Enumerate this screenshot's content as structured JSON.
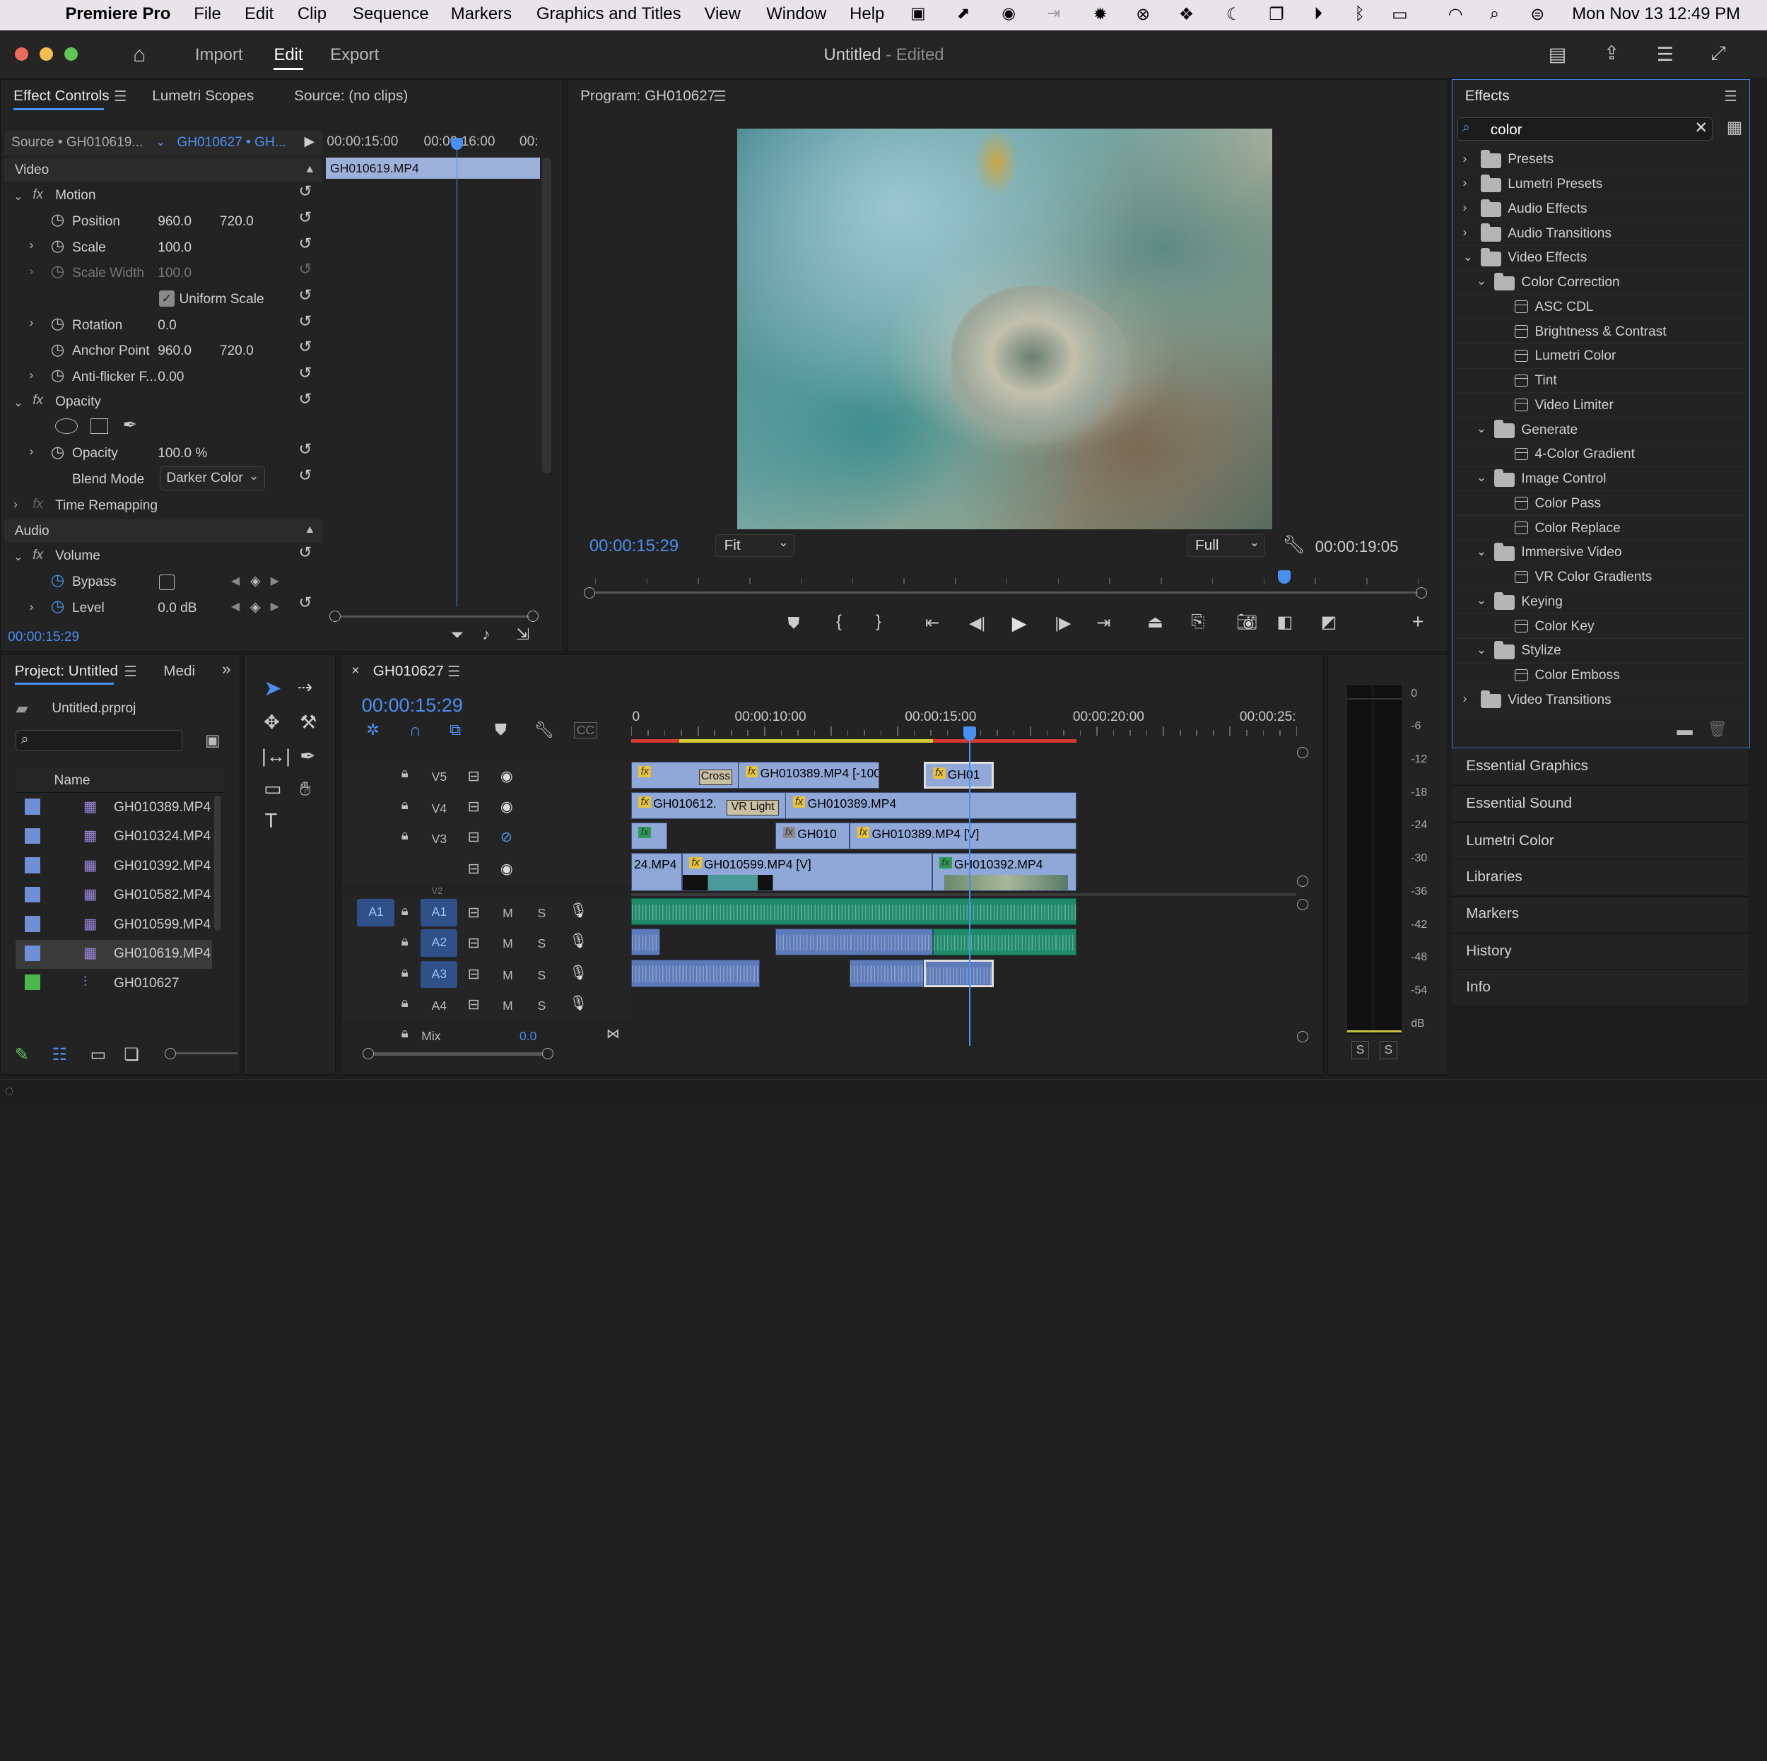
{
  "menubar": {
    "app": "Premiere Pro",
    "items": [
      "File",
      "Edit",
      "Clip",
      "Sequence",
      "Markers",
      "Graphics and Titles",
      "View",
      "Window",
      "Help"
    ],
    "datetime": "Mon Nov 13  12:49 PM"
  },
  "titlebar": {
    "tabs": [
      "Import",
      "Edit",
      "Export"
    ],
    "active_tab": "Edit",
    "doc_title": "Untitled",
    "doc_status": "- Edited"
  },
  "effect_controls": {
    "tabs": [
      "Effect Controls",
      "Lumetri Scopes",
      "Source: (no clips)"
    ],
    "source_label": "Source • GH010619...",
    "sequence_label": "GH010627 • GH...",
    "ruler_times": [
      "00:00:15:00",
      "00:00:16:00",
      "00:"
    ],
    "clip_name": "GH010619.MP4",
    "video_section": "Video",
    "motion": "Motion",
    "position_label": "Position",
    "position_x": "960.0",
    "position_y": "720.0",
    "scale_label": "Scale",
    "scale": "100.0",
    "scale_width_label": "Scale Width",
    "scale_width": "100.0",
    "uniform_scale": "Uniform Scale",
    "rotation_label": "Rotation",
    "rotation": "0.0",
    "anchor_label": "Anchor Point",
    "anchor_x": "960.0",
    "anchor_y": "720.0",
    "antiflicker_label": "Anti-flicker F...",
    "antiflicker": "0.00",
    "opacity_section": "Opacity",
    "opacity_label": "Opacity",
    "opacity": "100.0 %",
    "blend_label": "Blend Mode",
    "blend_mode": "Darker Color",
    "time_remap": "Time Remapping",
    "audio_section": "Audio",
    "volume": "Volume",
    "bypass_label": "Bypass",
    "level_label": "Level",
    "level": "0.0 dB",
    "current_time": "00:00:15:29"
  },
  "program": {
    "title": "Program: GH010627",
    "timecode": "00:00:15:29",
    "fit": "Fit",
    "quality": "Full",
    "duration": "00:00:19:05",
    "playhead_fraction": 0.837
  },
  "effects": {
    "title": "Effects",
    "search_value": "color",
    "tree": [
      {
        "label": "Presets",
        "level": 0,
        "type": "folder-star",
        "open": false
      },
      {
        "label": "Lumetri Presets",
        "level": 0,
        "type": "folder-star",
        "open": false
      },
      {
        "label": "Audio Effects",
        "level": 0,
        "type": "folder",
        "open": false
      },
      {
        "label": "Audio Transitions",
        "level": 0,
        "type": "folder",
        "open": false
      },
      {
        "label": "Video Effects",
        "level": 0,
        "type": "folder",
        "open": true
      },
      {
        "label": "Color Correction",
        "level": 1,
        "type": "folder",
        "open": true
      },
      {
        "label": "ASC CDL",
        "level": 2,
        "type": "fx"
      },
      {
        "label": "Brightness & Contrast",
        "level": 2,
        "type": "fx"
      },
      {
        "label": "Lumetri Color",
        "level": 2,
        "type": "fx"
      },
      {
        "label": "Tint",
        "level": 2,
        "type": "fx"
      },
      {
        "label": "Video Limiter",
        "level": 2,
        "type": "fx"
      },
      {
        "label": "Generate",
        "level": 1,
        "type": "folder",
        "open": true
      },
      {
        "label": "4-Color Gradient",
        "level": 2,
        "type": "fx"
      },
      {
        "label": "Image Control",
        "level": 1,
        "type": "folder",
        "open": true
      },
      {
        "label": "Color Pass",
        "level": 2,
        "type": "fx"
      },
      {
        "label": "Color Replace",
        "level": 2,
        "type": "fx"
      },
      {
        "label": "Immersive Video",
        "level": 1,
        "type": "folder",
        "open": true
      },
      {
        "label": "VR Color Gradients",
        "level": 2,
        "type": "fx"
      },
      {
        "label": "Keying",
        "level": 1,
        "type": "folder",
        "open": true
      },
      {
        "label": "Color Key",
        "level": 2,
        "type": "fx"
      },
      {
        "label": "Stylize",
        "level": 1,
        "type": "folder",
        "open": true
      },
      {
        "label": "Color Emboss",
        "level": 2,
        "type": "fx"
      },
      {
        "label": "Video Transitions",
        "level": 0,
        "type": "folder",
        "open": false
      }
    ]
  },
  "side_panels": [
    "Essential Graphics",
    "Essential Sound",
    "Lumetri Color",
    "Libraries",
    "Markers",
    "History",
    "Info"
  ],
  "project": {
    "tab": "Project: Untitled",
    "tab2": "Medi",
    "file": "Untitled.prproj",
    "name_col": "Name",
    "items": [
      {
        "name": "GH010389.MP4",
        "color": "#6f8fd6",
        "type": "clip"
      },
      {
        "name": "GH010324.MP4",
        "color": "#6f8fd6",
        "type": "clip"
      },
      {
        "name": "GH010392.MP4",
        "color": "#6f8fd6",
        "type": "clip"
      },
      {
        "name": "GH010582.MP4",
        "color": "#6f8fd6",
        "type": "clip"
      },
      {
        "name": "GH010599.MP4",
        "color": "#6f8fd6",
        "type": "clip"
      },
      {
        "name": "GH010619.MP4",
        "color": "#6f8fd6",
        "type": "clip",
        "selected": true
      },
      {
        "name": "GH010627",
        "color": "#4cb84c",
        "type": "sequence"
      }
    ]
  },
  "timeline": {
    "tab": "GH010627",
    "timecode": "00:00:15:29",
    "ruler": [
      "0",
      "00:00:10:00",
      "00:00:15:00",
      "00:00:20:00",
      "00:00:25:"
    ],
    "video_tracks": [
      "V5",
      "V4",
      "V3",
      "V2"
    ],
    "audio_tracks": [
      "A1",
      "A2",
      "A3",
      "A4"
    ],
    "source_patch": "A1",
    "mix_label": "Mix",
    "mix_value": "0.0",
    "m": "M",
    "s": "S",
    "clips": {
      "v5": [
        "Cross",
        "GH010389.MP4 [-100",
        "GH01"
      ],
      "v4": [
        "GH010612.",
        "VR Light",
        "GH010389.MP4"
      ],
      "v3": [
        "GH010",
        "GH010389.MP4 [V]"
      ],
      "v2": [
        "24.MP4",
        "GH010599.MP4 [V]",
        "GH010392.MP4"
      ]
    }
  },
  "meter": {
    "scale": [
      "0",
      "-6",
      "-12",
      "-18",
      "-24",
      "-30",
      "-36",
      "-42",
      "-48",
      "-54",
      "dB"
    ],
    "solo": [
      "S",
      "S"
    ]
  },
  "colors": {
    "accent": "#4a90f2",
    "clip_video": "#8fa8d8",
    "clip_audio": "#1f8a6a",
    "fx_badge": "#e7c23a",
    "in_out_red": "#d23b2f"
  }
}
